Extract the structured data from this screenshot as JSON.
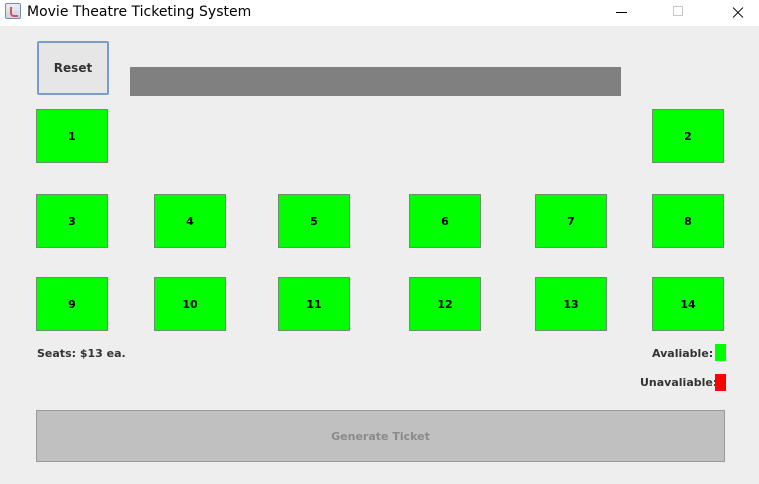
{
  "window": {
    "title": "Movie Theatre Ticketing System"
  },
  "toolbar": {
    "reset_label": "Reset"
  },
  "seats": [
    "1",
    "2",
    "3",
    "4",
    "5",
    "6",
    "7",
    "8",
    "9",
    "10",
    "11",
    "12",
    "13",
    "14"
  ],
  "info": {
    "price_label": "Seats: $13 ea.",
    "available_label": "Avaliable:",
    "unavailable_label": "Unavaliable:"
  },
  "colors": {
    "available": "#00ff00",
    "unavailable": "#ff0000",
    "screen": "#808080"
  },
  "actions": {
    "generate_label": "Generate Ticket"
  }
}
